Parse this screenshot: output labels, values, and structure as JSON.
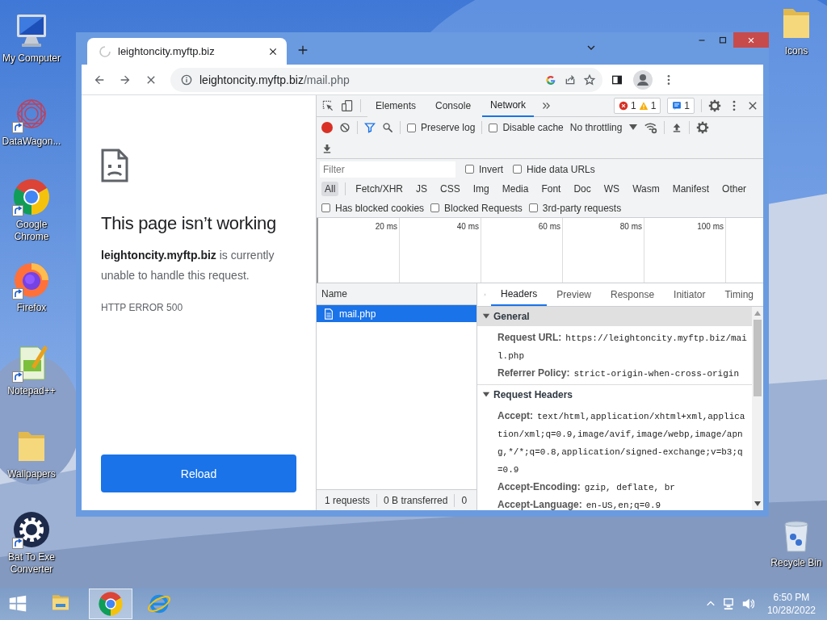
{
  "desktop": {
    "left_icons": [
      {
        "label": "My Computer",
        "kind": "computer",
        "shortcut": false
      },
      {
        "label": "DataWagon...",
        "kind": "star",
        "shortcut": true
      },
      {
        "label": "Google Chrome",
        "kind": "chrome",
        "shortcut": true
      },
      {
        "label": "Firefox",
        "kind": "firefox",
        "shortcut": true
      },
      {
        "label": "Notepad++",
        "kind": "notepad",
        "shortcut": true
      },
      {
        "label": "Wallpapers",
        "kind": "folder",
        "shortcut": false
      },
      {
        "label": "Bat To Exe Converter",
        "kind": "gear",
        "shortcut": true
      }
    ],
    "right_icons": [
      {
        "label": "Icons",
        "kind": "folder",
        "shortcut": false
      },
      {
        "label": "Recycle Bin",
        "kind": "recycle-bin",
        "shortcut": false
      }
    ]
  },
  "browser": {
    "tab_title": "leightoncity.myftp.biz",
    "loading": true,
    "address": {
      "host": "leightoncity.myftp.biz",
      "path": "/mail.php"
    }
  },
  "page": {
    "title": "This page isn’t working",
    "message": "**leightoncity.myftp.biz** is currently unable to handle this request.",
    "error_code": "HTTP ERROR 500",
    "button": "Reload"
  },
  "devtools": {
    "tabs": [
      {
        "label": "Elements",
        "selected": false
      },
      {
        "label": "Console",
        "selected": false
      },
      {
        "label": "Network",
        "selected": true
      }
    ],
    "issues": {
      "errors": "1",
      "warnings": "1",
      "messages": "1"
    },
    "recording": true,
    "preserve_log": {
      "label": "Preserve log",
      "checked": false
    },
    "disable_cache": {
      "label": "Disable cache",
      "checked": false
    },
    "throttling": "No throttling",
    "filter": {
      "placeholder": "Filter"
    },
    "filter_options": [
      {
        "label": "Invert",
        "checked": false
      },
      {
        "label": "Hide data URLs",
        "checked": false
      }
    ],
    "type_filters": [
      {
        "label": "All",
        "selected": true
      },
      {
        "label": "Fetch/XHR",
        "selected": false
      },
      {
        "label": "JS",
        "selected": false
      },
      {
        "label": "CSS",
        "selected": false
      },
      {
        "label": "Img",
        "selected": false
      },
      {
        "label": "Media",
        "selected": false
      },
      {
        "label": "Font",
        "selected": false
      },
      {
        "label": "Doc",
        "selected": false
      },
      {
        "label": "WS",
        "selected": false
      },
      {
        "label": "Wasm",
        "selected": false
      },
      {
        "label": "Manifest",
        "selected": false
      },
      {
        "label": "Other",
        "selected": false
      }
    ],
    "request_options": [
      {
        "label": "Has blocked cookies",
        "checked": false
      },
      {
        "label": "Blocked Requests",
        "checked": false
      },
      {
        "label": "3rd-party requests",
        "checked": false
      }
    ],
    "timeline_ticks": [
      "20 ms",
      "40 ms",
      "60 ms",
      "80 ms",
      "100 ms"
    ],
    "requests": {
      "column": "Name",
      "rows": [
        {
          "name": "mail.php",
          "selected": true
        }
      ]
    },
    "summary": [
      "1 requests",
      "0 B transferred",
      "0"
    ],
    "detail_tabs": [
      {
        "label": "Headers",
        "selected": true
      },
      {
        "label": "Preview",
        "selected": false
      },
      {
        "label": "Response",
        "selected": false
      },
      {
        "label": "Initiator",
        "selected": false
      },
      {
        "label": "Timing",
        "selected": false
      }
    ],
    "sections": [
      {
        "title": "General",
        "expanded": true,
        "focused": true,
        "rows": [
          {
            "name": "Request URL:",
            "value": "https://leightoncity.myftp.biz/mail.php"
          },
          {
            "name": "Referrer Policy:",
            "value": "strict-origin-when-cross-origin"
          }
        ]
      },
      {
        "title": "Request Headers",
        "expanded": true,
        "focused": false,
        "rows": [
          {
            "name": "Accept:",
            "value": "text/html,application/xhtml+xml,application/xml;q=0.9,image/avif,image/webp,image/apng,*/*;q=0.8,application/signed-exchange;v=b3;q=0.9"
          },
          {
            "name": "Accept-Encoding:",
            "value": "gzip, deflate, br"
          },
          {
            "name": "Accept-Language:",
            "value": "en-US,en;q=0.9"
          }
        ]
      }
    ]
  },
  "taskbar": {
    "apps": [
      {
        "kind": "explorer",
        "selected": false
      },
      {
        "kind": "chrome",
        "selected": true
      },
      {
        "kind": "ie",
        "selected": false
      }
    ],
    "time": "6:50 PM",
    "date": "10/28/2022"
  }
}
